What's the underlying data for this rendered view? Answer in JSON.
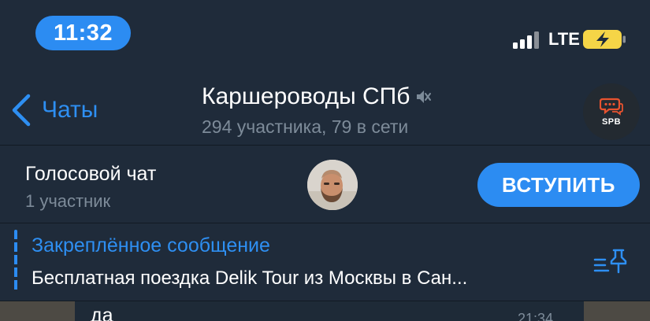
{
  "status_bar": {
    "time": "11:32",
    "network": "LTE",
    "signal_bars_active": 3,
    "signal_bars_total": 4
  },
  "nav": {
    "back_label": "Чаты",
    "title": "Каршероводы СПб",
    "subtitle": "294 участника, 79 в сети",
    "avatar_text": "SPB",
    "icons": {
      "back": "chevron-left-icon",
      "mute": "muted-speaker-icon"
    }
  },
  "voice_chat": {
    "title": "Голосовой чат",
    "subtitle": "1 участник",
    "join_label": "ВСТУПИТЬ"
  },
  "pinned": {
    "title": "Закреплённое сообщение",
    "text": "Бесплатная поездка Delik Tour из Москвы в Сан...",
    "icon": "pinned-list-icon"
  },
  "message": {
    "text": "да",
    "time": "21:34"
  },
  "colors": {
    "background": "#1f2b3a",
    "accent": "#2c8cf2",
    "secondary_text": "#7d8b99",
    "battery_fill": "#f5d547"
  }
}
